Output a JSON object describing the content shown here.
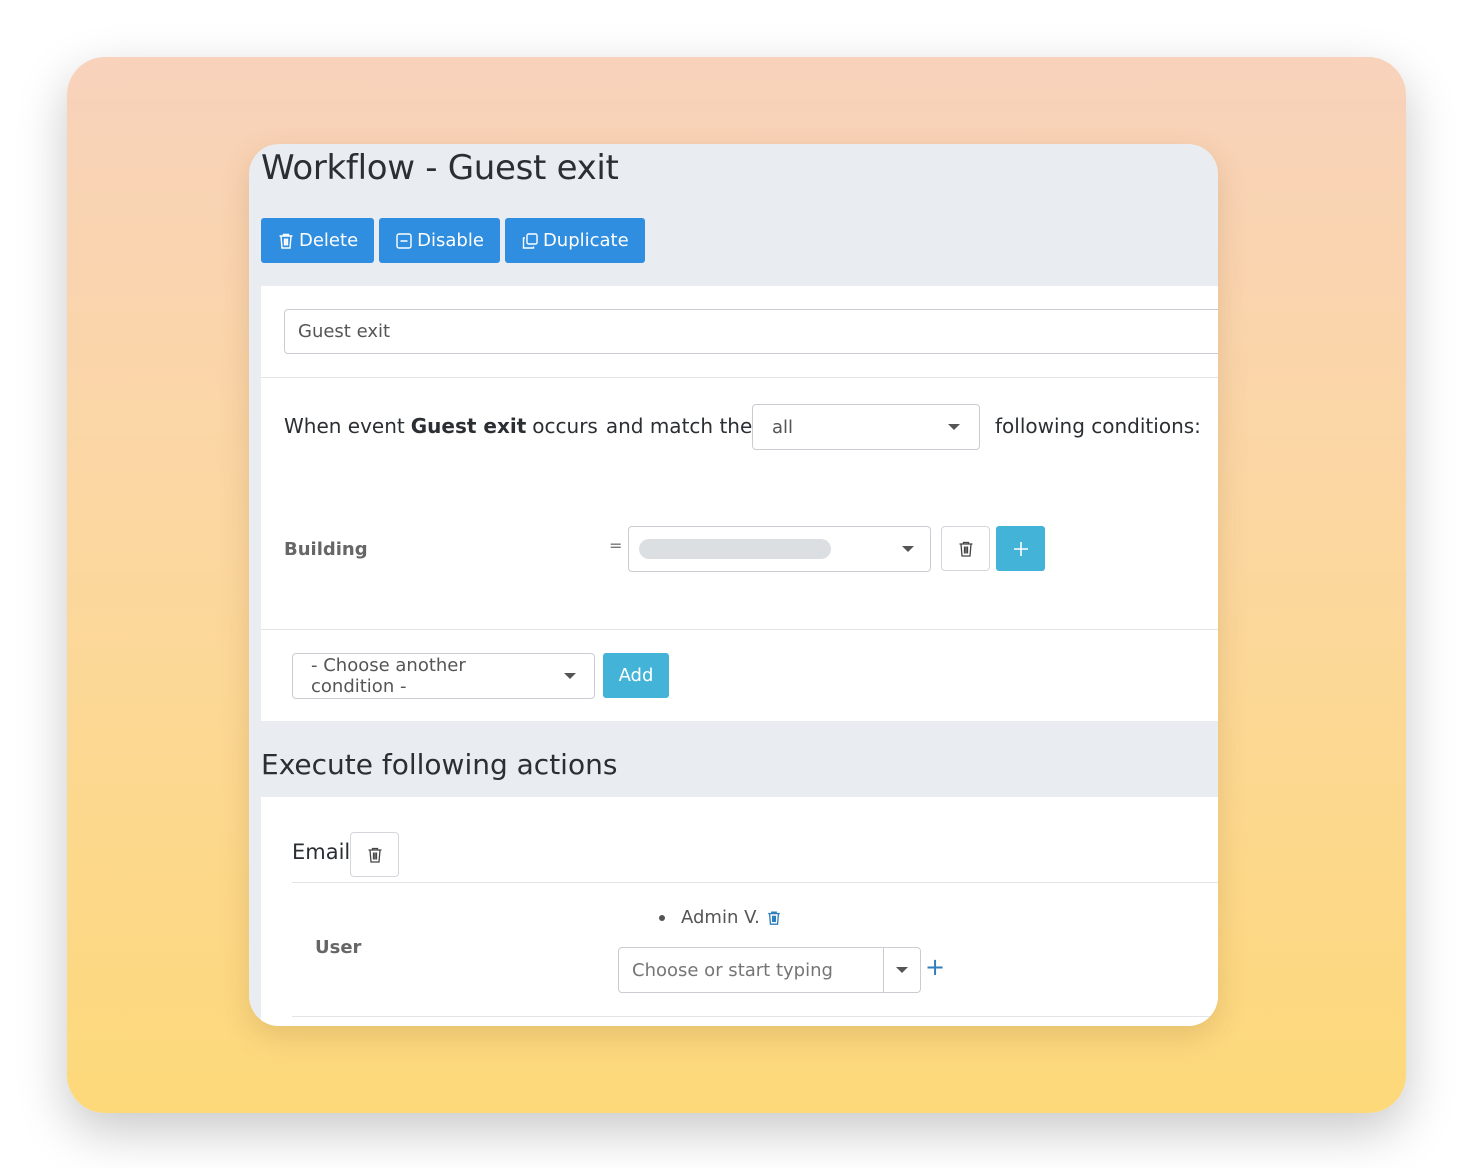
{
  "workflow": {
    "title": "Workflow - Guest exit",
    "toolbar": {
      "delete_label": "Delete",
      "disable_label": "Disable",
      "duplicate_label": "Duplicate"
    },
    "name_value": "Guest exit"
  },
  "conditions": {
    "intro": "When event",
    "event_name": "Guest exit",
    "occurs": "occurs",
    "match_text": "and match the",
    "match_selected": "all",
    "following_text": "following conditions:",
    "rows": [
      {
        "label": "Building",
        "operator": "="
      }
    ],
    "another_placeholder": "- Choose another condition -",
    "add_label": "Add"
  },
  "actions": {
    "section_title": "Execute following actions",
    "email": {
      "label": "Email",
      "user_label": "User",
      "users": [
        "Admin V."
      ],
      "user_input_placeholder": "Choose or start typing",
      "add_symbol": "+"
    }
  },
  "colors": {
    "primary": "#2f8ee0",
    "info": "#43b4d8",
    "card_bg": "#e9ecf0"
  }
}
